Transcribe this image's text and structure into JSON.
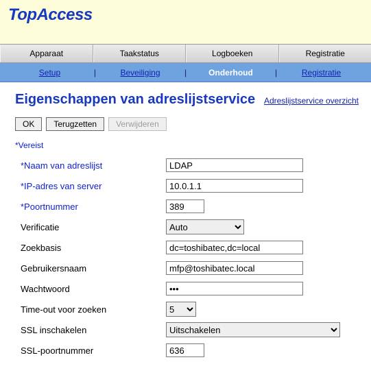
{
  "logo": "TopAccess",
  "nav1": {
    "tabs": [
      "Apparaat",
      "Taakstatus",
      "Logboeken",
      "Registratie"
    ]
  },
  "nav2": {
    "items": [
      "Setup",
      "Beveiliging",
      "Onderhoud",
      "Registratie"
    ],
    "active_index": 2
  },
  "page": {
    "title": "Eigenschappen van adreslijstservice",
    "overview_link": "Adreslijstservice overzicht"
  },
  "buttons": {
    "ok": "OK",
    "reset": "Terugzetten",
    "delete": "Verwijderen"
  },
  "required_note": "*Vereist",
  "form": {
    "name": {
      "label": "*Naam van adreslijst",
      "value": "LDAP"
    },
    "ip": {
      "label": "*IP-adres van server",
      "value": "10.0.1.1"
    },
    "port": {
      "label": "*Poortnummer",
      "value": "389"
    },
    "auth": {
      "label": "Verificatie",
      "value": "Auto"
    },
    "searchbase": {
      "label": "Zoekbasis",
      "value": "dc=toshibatec,dc=local"
    },
    "username": {
      "label": "Gebruikersnaam",
      "value": "mfp@toshibatec.local"
    },
    "password": {
      "label": "Wachtwoord",
      "value": "•••"
    },
    "timeout": {
      "label": "Time-out voor zoeken",
      "value": "5"
    },
    "ssl_enable": {
      "label": "SSL inschakelen",
      "value": "Uitschakelen"
    },
    "ssl_port": {
      "label": "SSL-poortnummer",
      "value": "636"
    }
  }
}
